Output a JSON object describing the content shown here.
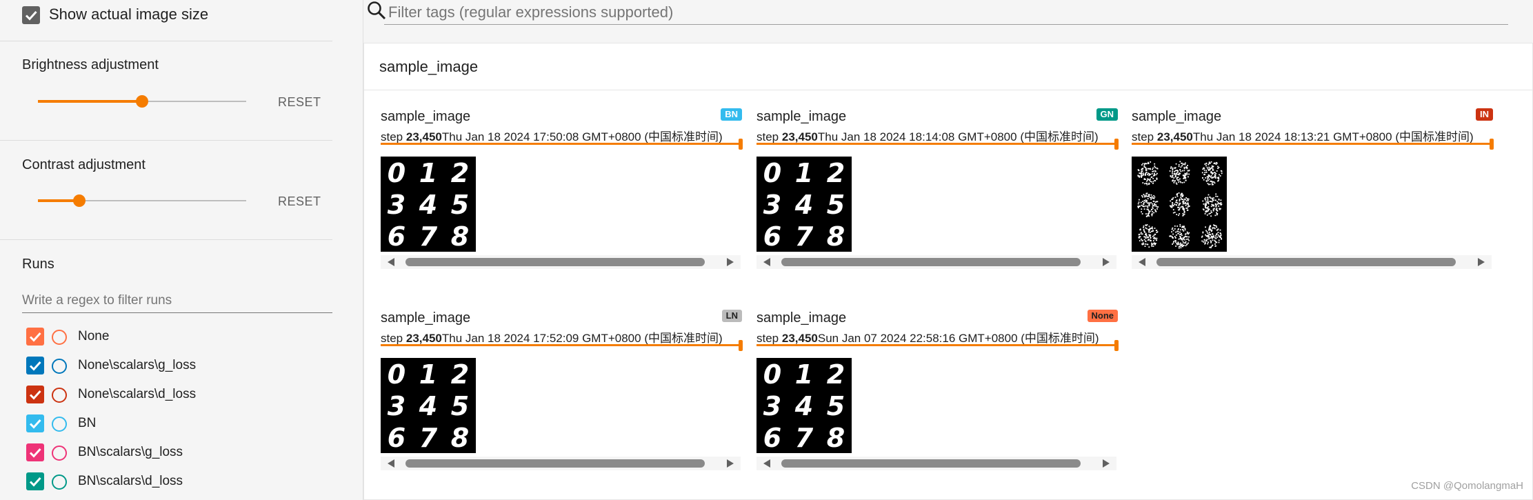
{
  "sidebar": {
    "show_actual_size": {
      "label": "Show actual image size",
      "checked": true
    },
    "brightness": {
      "title": "Brightness adjustment",
      "value": 0.5,
      "reset_label": "RESET"
    },
    "contrast": {
      "title": "Contrast adjustment",
      "value": 0.2,
      "reset_label": "RESET"
    },
    "runs": {
      "title": "Runs",
      "filter_placeholder": "Write a regex to filter runs",
      "items": [
        {
          "label": "None",
          "color": "#ff7043",
          "checked": true
        },
        {
          "label": "None\\scalars\\g_loss",
          "color": "#0077bb",
          "checked": true
        },
        {
          "label": "None\\scalars\\d_loss",
          "color": "#cc3311",
          "checked": true
        },
        {
          "label": "BN",
          "color": "#33bbee",
          "checked": true
        },
        {
          "label": "BN\\scalars\\g_loss",
          "color": "#ee3377",
          "checked": true
        },
        {
          "label": "BN\\scalars\\d_loss",
          "color": "#009988",
          "checked": true
        }
      ]
    }
  },
  "main": {
    "tag_filter_placeholder": "Filter tags (regular expressions supported)",
    "group_title": "sample_image",
    "cards": [
      {
        "title": "sample_image",
        "badge": "BN",
        "badge_color": "#33bbee",
        "step_prefix": "step ",
        "step": "23,450",
        "time": "Thu Jan 18 2024 17:50:08 GMT+0800 (中国标准时间)",
        "image": "digits-clear-a"
      },
      {
        "title": "sample_image",
        "badge": "GN",
        "badge_color": "#009988",
        "step_prefix": "step ",
        "step": "23,450",
        "time": "Thu Jan 18 2024 18:14:08 GMT+0800 (中国标准时间)",
        "image": "digits-clear-b"
      },
      {
        "title": "sample_image",
        "badge": "IN",
        "badge_color": "#cc3311",
        "step_prefix": "step ",
        "step": "23,450",
        "time": "Thu Jan 18 2024 18:13:21 GMT+0800 (中国标准时间)",
        "image": "digits-noise"
      },
      {
        "title": "sample_image",
        "badge": "LN",
        "badge_color": "#bbbbbb",
        "step_prefix": "step ",
        "step": "23,450",
        "time": "Thu Jan 18 2024 17:52:09 GMT+0800 (中国标准时间)",
        "image": "digits-clear-c"
      },
      {
        "title": "sample_image",
        "badge": "None",
        "badge_color": "#ff7043",
        "step_prefix": "step ",
        "step": "23,450",
        "time": "Sun Jan 07 2024 22:58:16 GMT+0800 (中国标准时间)",
        "image": "digits-clear-d"
      }
    ],
    "sample_digits": [
      "0",
      "1",
      "2",
      "3",
      "4",
      "5",
      "6",
      "7",
      "8"
    ]
  },
  "watermark": "CSDN @QomolangmaH"
}
